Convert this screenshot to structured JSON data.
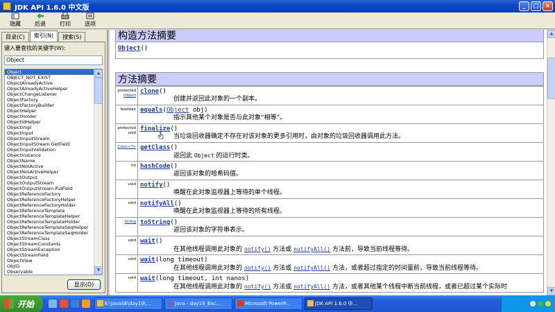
{
  "window": {
    "title": "JDK API 1.6.0 中文版"
  },
  "toolbar": {
    "buttons": [
      {
        "label": "隐藏",
        "icon": "hide-icon"
      },
      {
        "label": "后退",
        "icon": "back-arrow-icon"
      },
      {
        "label": "打印",
        "icon": "printer-icon"
      },
      {
        "label": "选项",
        "icon": "options-icon"
      }
    ]
  },
  "nav": {
    "tabs": [
      "目录(C)",
      "索引(N)",
      "搜索(S)"
    ],
    "active_tab": 1,
    "keyword_label": "键入要查找的关键字(W):",
    "keyword_value": "Object",
    "show_button": "显示(D)",
    "items": [
      "Object",
      "OBJECT_NOT_EXIST",
      "ObjectAlreadyActive",
      "ObjectAlreadyActiveHelper",
      "ObjectChangeListener",
      "ObjectFactory",
      "ObjectFactoryBuilder",
      "ObjectHelper",
      "ObjectHolder",
      "ObjectIdHelper",
      "ObjectImpl",
      "ObjectInput",
      "ObjectInputStream",
      "ObjectInputStream.GetField",
      "ObjectInputValidation",
      "ObjectInstance",
      "ObjectName",
      "ObjectNotActive",
      "ObjectNotActiveHelper",
      "ObjectOutput",
      "ObjectOutputStream",
      "ObjectOutputStream.PutField",
      "ObjectReferenceFactory",
      "ObjectReferenceFactoryHelper",
      "ObjectReferenceFactoryHolder",
      "ObjectReferenceTemplate",
      "ObjectReferenceTemplateHelper",
      "ObjectReferenceTemplateHolder",
      "ObjectReferenceTemplateSeqHelper",
      "ObjectReferenceTemplateSeqHolder",
      "ObjectStreamClass",
      "ObjectStreamConstants",
      "ObjectStreamException",
      "ObjectStreamField",
      "ObjectView",
      "ObjID",
      "Observable"
    ]
  },
  "content": {
    "ctor_header": "构造方法摘要",
    "ctor": {
      "name": "Object",
      "params": "()"
    },
    "method_header": "方法摘要",
    "methods": [
      {
        "mod": "protected",
        "ret": "Object",
        "name": "clone",
        "params": "()",
        "desc": "创建并返回此对象的一个副本。"
      },
      {
        "mod": "boolean",
        "name": "equals",
        "params_pre": "(",
        "param_type": "Object",
        "params_post": " obj)",
        "desc": "指示其他某个对象是否与此对象“相等”。"
      },
      {
        "mod": "protected",
        "mod2": "void",
        "name": "finalize",
        "params": "()",
        "desc": "当垃圾回收器确定不存在对该对象的更多引用时，由对象的垃圾回收器调用此方法。"
      },
      {
        "mod": "Class<?>",
        "name": "getClass",
        "params": "()",
        "desc_pre": "返回此 ",
        "desc_code": "Object",
        "desc_post": " 的运行时类。"
      },
      {
        "mod": "int",
        "name": "hashCode",
        "params": "()",
        "desc": "返回该对象的哈希码值。"
      },
      {
        "mod": "void",
        "name": "notify",
        "params": "()",
        "desc": "唤醒在此对象监视器上等待的单个线程。"
      },
      {
        "mod": "void",
        "name": "notifyAll",
        "params": "()",
        "desc": "唤醒在此对象监视器上等待的所有线程。"
      },
      {
        "mod": "String",
        "name": "toString",
        "params": "()",
        "desc": "返回该对象的字符串表示。"
      },
      {
        "mod": "void",
        "name": "wait",
        "params": "()",
        "d1": "在其他线程调用此对象的 ",
        "l1": "notify()",
        "d2": " 方法或 ",
        "l2": "notifyAll()",
        "d3": " 方法前，导致当前线程等待。"
      },
      {
        "mod": "void",
        "name": "wait",
        "params": "(long timeout)",
        "d1": "在其他线程调用此对象的 ",
        "l1": "notify()",
        "d2": " 方法或 ",
        "l2": "notifyAll()",
        "d3": " 方法，或者超过指定的时间量前，导致当前线程等待。"
      },
      {
        "mod": "void",
        "name": "wait",
        "params": "(long timeout, int nanos)",
        "d1": "在其他线程调用此对象的 ",
        "l1": "notify()",
        "d2": " 方法或 ",
        "l2": "notifyAll()",
        "d3": " 方法，或者其他某个线程中断当前线程，或者已超过某个实际时"
      }
    ]
  },
  "taskbar": {
    "start": "开始",
    "tasks": [
      {
        "label": "E:\\JavaSE\\day19\\...",
        "color": "#f0c040"
      },
      {
        "label": "Java - day19_Exc...",
        "color": "#7a5ccc"
      },
      {
        "label": "Microsoft PowerP...",
        "color": "#d04020"
      },
      {
        "label": "JDK API 1.6.0 中...",
        "color": "#f0c040"
      }
    ]
  }
}
